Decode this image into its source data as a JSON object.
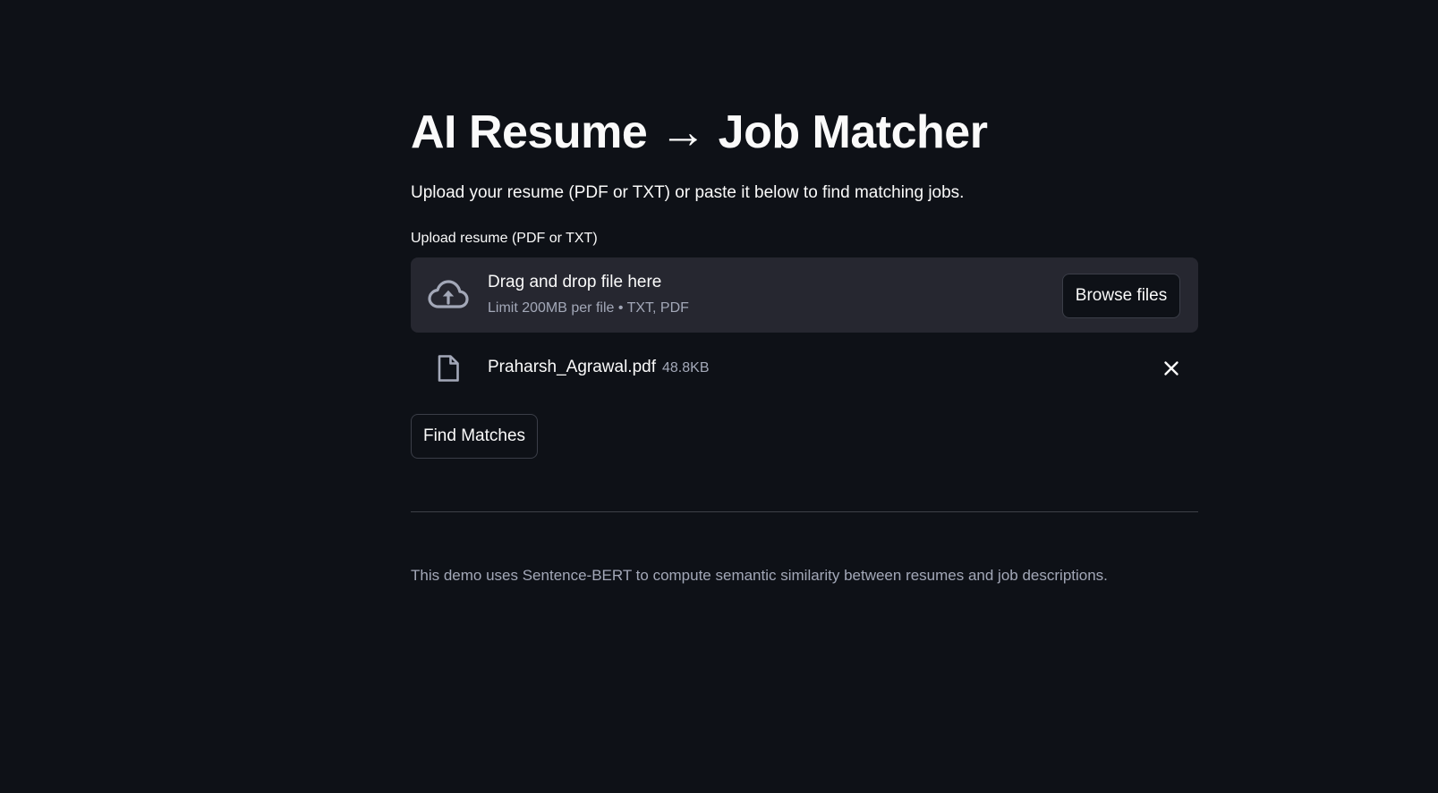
{
  "page": {
    "title": "AI Resume → Job Matcher",
    "subtitle": "Upload your resume (PDF or TXT) or paste it below to find matching jobs."
  },
  "uploader": {
    "label": "Upload resume (PDF or TXT)",
    "drop_title": "Drag and drop file here",
    "drop_limit": "Limit 200MB per file • TXT, PDF",
    "browse_label": "Browse files",
    "icon": "cloud-upload-icon"
  },
  "uploaded_file": {
    "name": "Praharsh_Agrawal.pdf",
    "size": "48.8KB",
    "icon": "file-icon",
    "remove_icon": "close-icon"
  },
  "actions": {
    "find_label": "Find Matches"
  },
  "footer": {
    "caption": "This demo uses Sentence-BERT to compute semantic similarity between resumes and job descriptions."
  },
  "colors": {
    "background": "#0e1117",
    "text": "#fafafa",
    "muted_text": "#a3a8b8",
    "dropzone_bg": "#262730",
    "border": "#3b3e48"
  }
}
